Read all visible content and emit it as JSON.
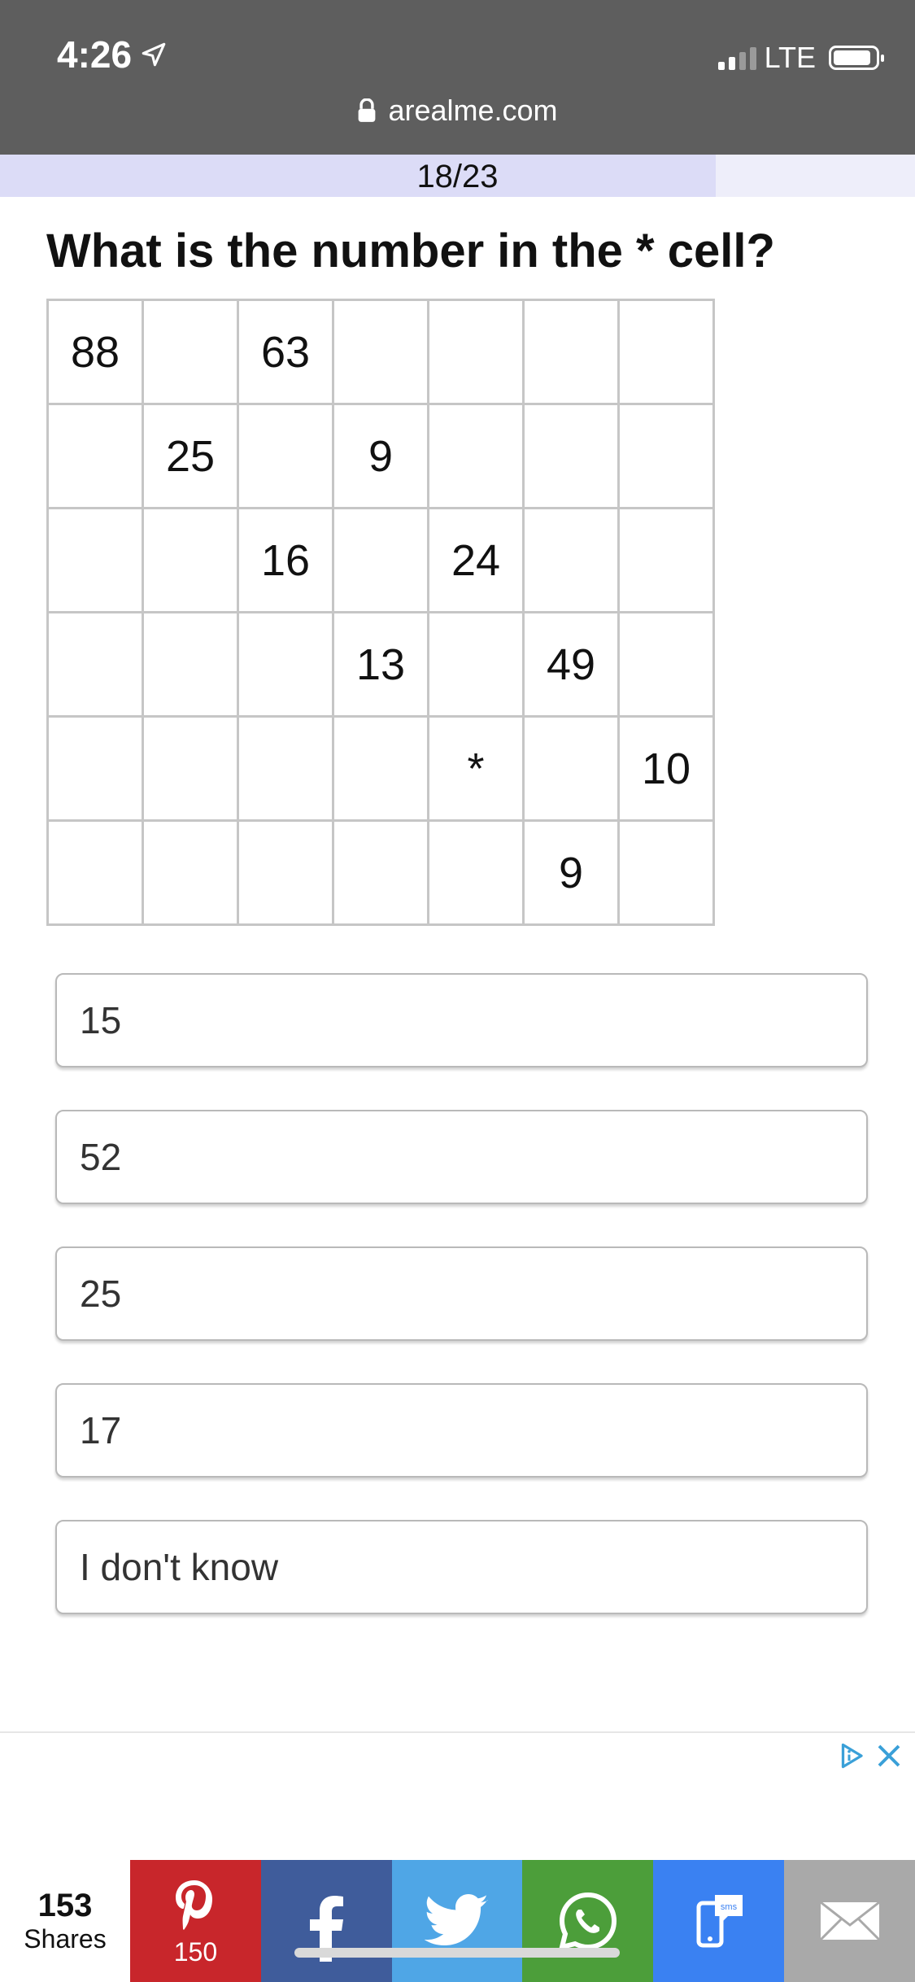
{
  "status_bar": {
    "time": "4:26",
    "network": "LTE"
  },
  "browser": {
    "url": "arealme.com"
  },
  "quiz": {
    "progress_label": "18/23",
    "progress_fraction": 0.7826,
    "question": "What is the number in the * cell?",
    "grid": [
      [
        "88",
        "",
        "63",
        "",
        "",
        "",
        ""
      ],
      [
        "",
        "25",
        "",
        "9",
        "",
        "",
        ""
      ],
      [
        "",
        "",
        "16",
        "",
        "24",
        "",
        ""
      ],
      [
        "",
        "",
        "",
        "13",
        "",
        "49",
        ""
      ],
      [
        "",
        "",
        "",
        "",
        "*",
        "",
        "10"
      ],
      [
        "",
        "",
        "",
        "",
        "",
        "9",
        ""
      ]
    ],
    "answers": [
      "15",
      "52",
      "25",
      "17",
      "I don't know"
    ]
  },
  "share_bar": {
    "total_count": "153",
    "total_label": "Shares",
    "pinterest_count": "150",
    "colors": {
      "pinterest": "#c8262b",
      "facebook": "#3f5c9b",
      "twitter": "#4fa6e6",
      "whatsapp": "#4c9e3a",
      "sms": "#3a81f2",
      "email": "#a9a9a9"
    }
  },
  "icons": {
    "location": "location-arrow-icon",
    "lock": "lock-icon",
    "ad_choices": "adchoices-icon",
    "ad_close": "close-icon"
  }
}
